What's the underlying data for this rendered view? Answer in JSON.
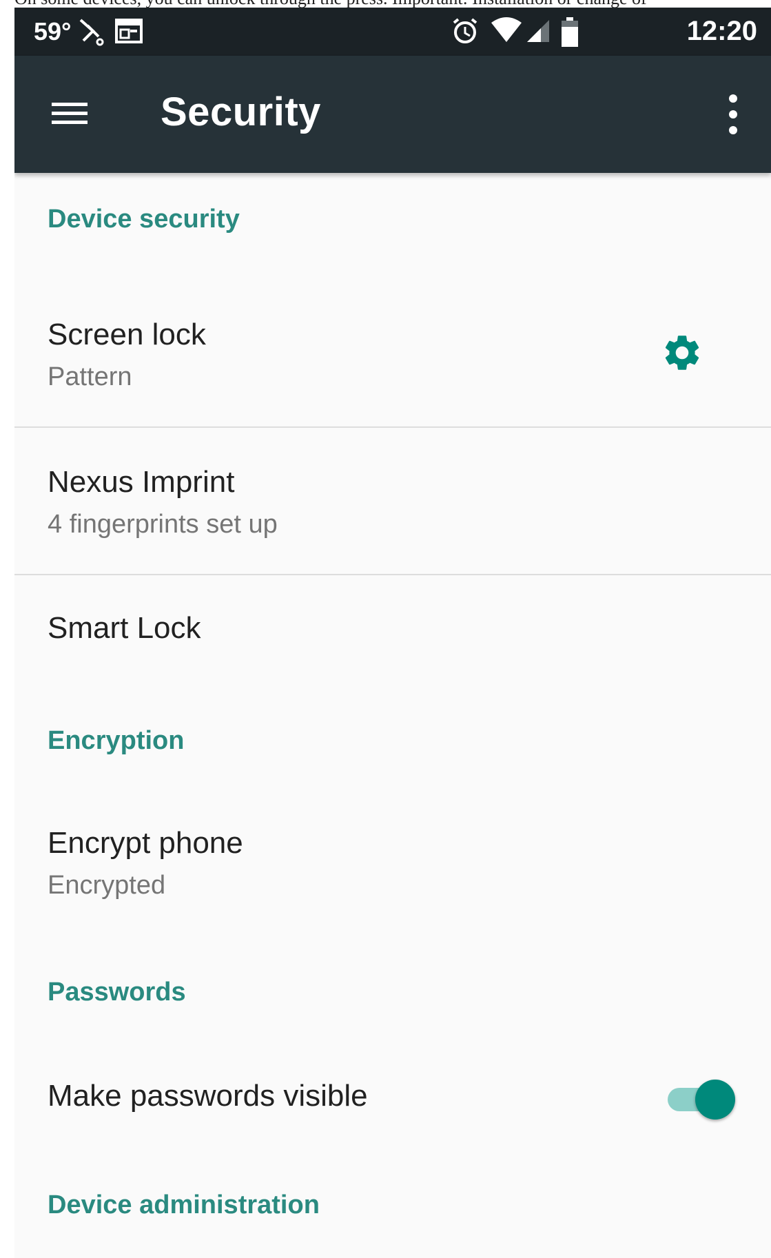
{
  "caption": "On some devices, you can unlock through the press. Important: Installation or change of",
  "status_bar": {
    "temperature": "59°",
    "icons": [
      "missed-call-icon",
      "calendar-icon",
      "alarm-icon",
      "wifi-icon",
      "signal-icon",
      "battery-icon"
    ],
    "time": "12:20"
  },
  "app_bar": {
    "title": "Security",
    "menu_icon": "hamburger-menu-icon",
    "overflow_icon": "more-vert-icon"
  },
  "colors": {
    "app_bar": "#263238",
    "status_bar": "#1b2226",
    "accent": "#00897b",
    "section_header": "#2a8a80",
    "background": "#fafafa"
  },
  "sections": {
    "device_security": "Device security",
    "encryption": "Encryption",
    "passwords": "Passwords",
    "device_administration": "Device administration"
  },
  "items": {
    "screen_lock": {
      "title": "Screen lock",
      "summary": "Pattern",
      "icon": "gear-icon"
    },
    "nexus_imprint": {
      "title": "Nexus Imprint",
      "summary": "4 fingerprints set up"
    },
    "smart_lock": {
      "title": "Smart Lock"
    },
    "encrypt_phone": {
      "title": "Encrypt phone",
      "summary": "Encrypted"
    },
    "make_passwords_visible": {
      "title": "Make passwords visible",
      "toggle_on": true
    }
  }
}
